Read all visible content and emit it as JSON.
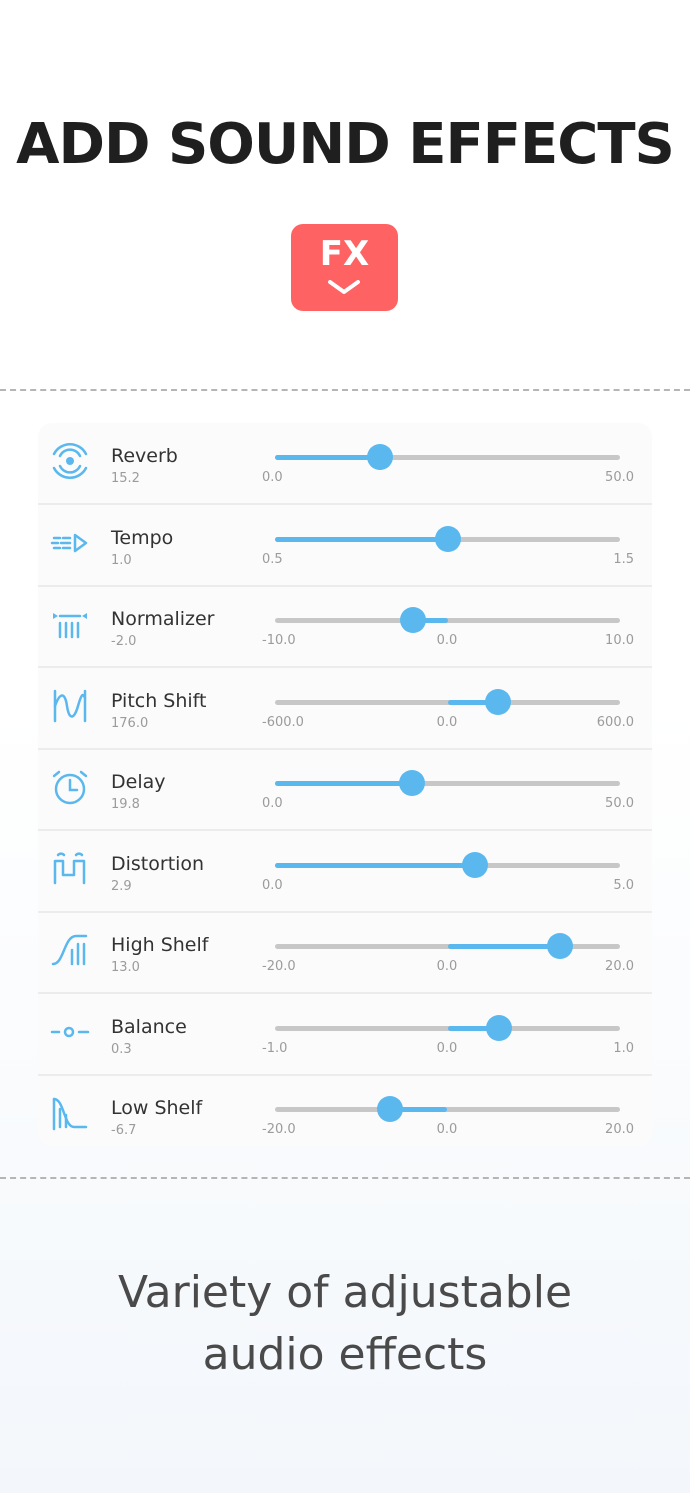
{
  "headline": "ADD SOUND EFFECTS",
  "badge": {
    "text": "FX",
    "color": "#ff6262"
  },
  "accent_color": "#5bb8ee",
  "effects": [
    {
      "name": "Reverb",
      "value": "15.2",
      "min": "0.0",
      "mid": "",
      "max": "50.0",
      "icon": "reverb-icon",
      "fraction": 0.304,
      "center": false
    },
    {
      "name": "Tempo",
      "value": "1.0",
      "min": "0.5",
      "mid": "",
      "max": "1.5",
      "icon": "tempo-icon",
      "fraction": 0.5,
      "center": false
    },
    {
      "name": "Normalizer",
      "value": "-2.0",
      "min": "-10.0",
      "mid": "0.0",
      "max": "10.0",
      "icon": "normalizer-icon",
      "fraction": 0.4,
      "center": true
    },
    {
      "name": "Pitch Shift",
      "value": "176.0",
      "min": "-600.0",
      "mid": "0.0",
      "max": "600.0",
      "icon": "pitch-shift-icon",
      "fraction": 0.647,
      "center": true
    },
    {
      "name": "Delay",
      "value": "19.8",
      "min": "0.0",
      "mid": "",
      "max": "50.0",
      "icon": "delay-icon",
      "fraction": 0.396,
      "center": false
    },
    {
      "name": "Distortion",
      "value": "2.9",
      "min": "0.0",
      "mid": "",
      "max": "5.0",
      "icon": "distortion-icon",
      "fraction": 0.58,
      "center": false
    },
    {
      "name": "High Shelf",
      "value": "13.0",
      "min": "-20.0",
      "mid": "0.0",
      "max": "20.0",
      "icon": "high-shelf-icon",
      "fraction": 0.825,
      "center": true
    },
    {
      "name": "Balance",
      "value": "0.3",
      "min": "-1.0",
      "mid": "0.0",
      "max": "1.0",
      "icon": "balance-icon",
      "fraction": 0.65,
      "center": true
    },
    {
      "name": "Low Shelf",
      "value": "-6.7",
      "min": "-20.0",
      "mid": "0.0",
      "max": "20.0",
      "icon": "low-shelf-icon",
      "fraction": 0.3325,
      "center": true
    }
  ],
  "caption_line1": "Variety of adjustable",
  "caption_line2": "audio effects"
}
